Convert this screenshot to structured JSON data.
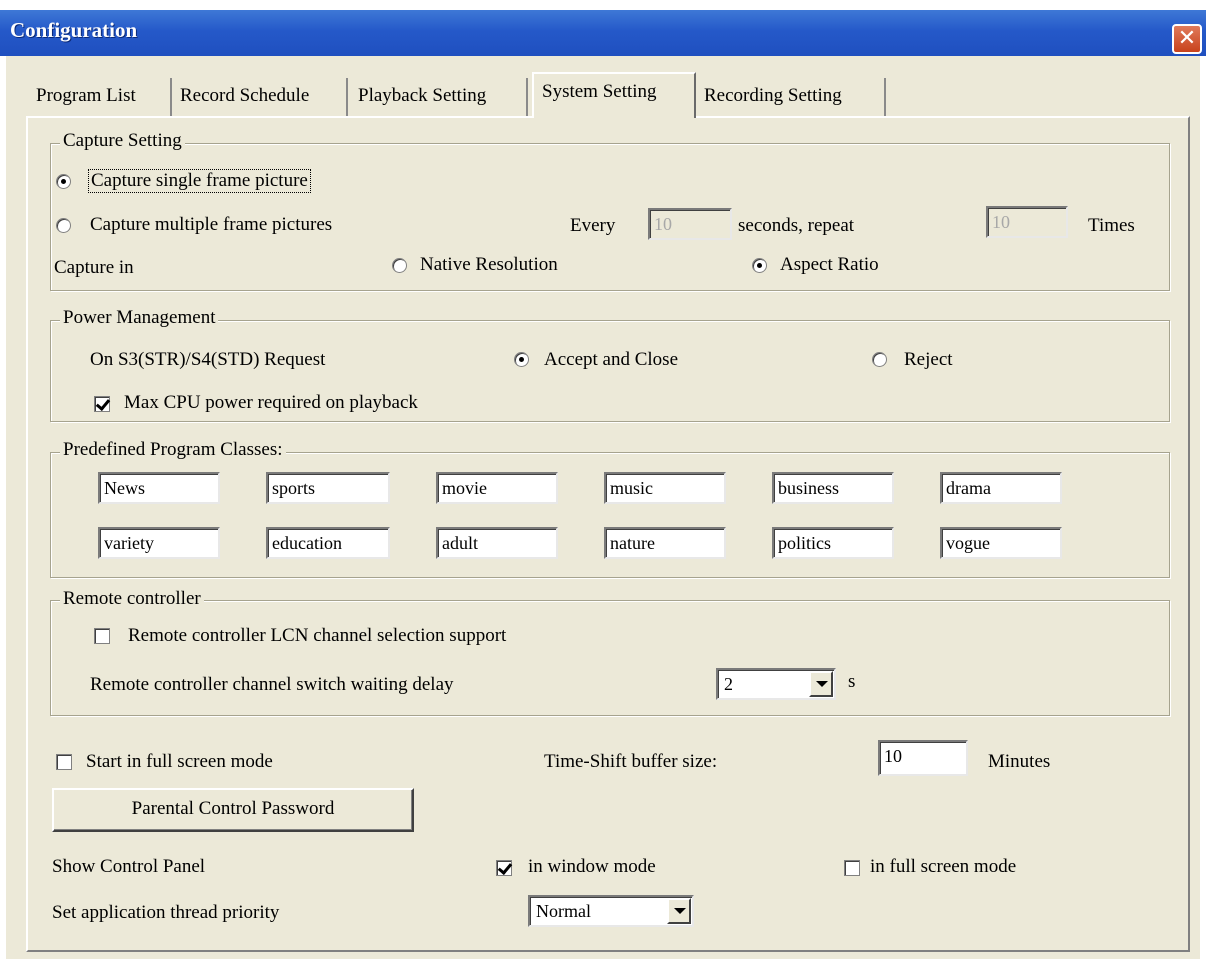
{
  "window": {
    "title": "Configuration",
    "close_glyph": "✕"
  },
  "tabs": [
    {
      "label": "Program List"
    },
    {
      "label": "Record Schedule"
    },
    {
      "label": "Playback Setting"
    },
    {
      "label": "System Setting",
      "selected": true
    },
    {
      "label": "Recording Setting"
    }
  ],
  "capture": {
    "legend": "Capture Setting",
    "single_label": "Capture single frame picture",
    "multiple_label": "Capture multiple frame pictures",
    "every_label": "Every",
    "every_value": "10",
    "seconds_repeat_label": "seconds, repeat",
    "times_value": "10",
    "times_label": "Times",
    "capture_in_label": "Capture in",
    "native_label": "Native Resolution",
    "aspect_label": "Aspect Ratio",
    "selected_mode": "single",
    "selected_resolution": "aspect"
  },
  "power": {
    "legend": "Power Management",
    "request_label": "On S3(STR)/S4(STD) Request",
    "accept_label": "Accept and Close",
    "reject_label": "Reject",
    "max_cpu_label": "Max CPU power required on playback",
    "max_cpu_checked": true
  },
  "classes": {
    "legend": "Predefined Program Classes:",
    "row1": [
      "News",
      "sports",
      "movie",
      "music",
      "business",
      "drama"
    ],
    "row2": [
      "variety",
      "education",
      "adult",
      "nature",
      "politics",
      "vogue"
    ]
  },
  "remote": {
    "legend": "Remote controller",
    "lcn_label": "Remote controller LCN channel selection support",
    "lcn_checked": false,
    "delay_label": "Remote controller channel switch waiting delay",
    "delay_value": "2",
    "delay_unit": "s"
  },
  "general": {
    "fullscreen_label": "Start in full screen mode",
    "fullscreen_checked": false,
    "timeshift_label": "Time-Shift buffer size:",
    "timeshift_value": "10",
    "timeshift_unit": "Minutes",
    "parental_button": "Parental Control Password",
    "show_panel_label": "Show Control Panel",
    "window_mode_label": "in window mode",
    "window_mode_checked": true,
    "fullscreen_mode_label": "in full screen mode",
    "fullscreen_mode_checked": false,
    "priority_label": "Set application thread priority",
    "priority_value": "Normal"
  },
  "colors": {
    "titlebar": "#2559c9",
    "face": "#ece9d8",
    "close": "#c8421c"
  }
}
